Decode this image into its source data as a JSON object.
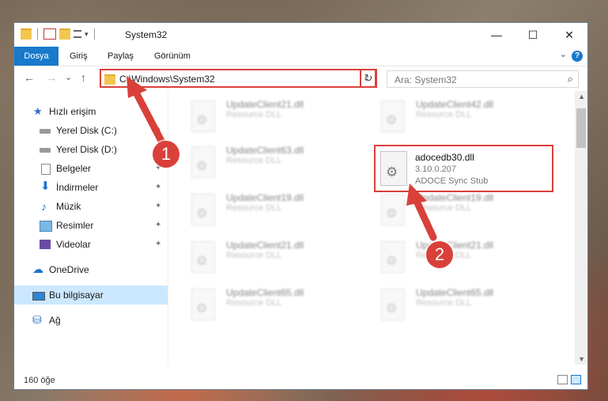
{
  "window": {
    "title": "System32",
    "minimize_glyph": "—",
    "maximize_glyph": "☐",
    "close_glyph": "✕"
  },
  "ribbon": {
    "tabs": [
      "Dosya",
      "Giriş",
      "Paylaş",
      "Görünüm"
    ],
    "help_glyph": "?",
    "collapse_glyph": "⌄"
  },
  "navigation": {
    "back_glyph": "←",
    "forward_glyph": "→",
    "recent_glyph": "⌄",
    "up_glyph": "↑",
    "address_path": "C:\\Windows\\System32",
    "address_dropdown_glyph": "⌄",
    "refresh_glyph": "↻",
    "search_placeholder": "Ara: System32",
    "search_glyph": "⌕"
  },
  "sidebar": {
    "items": [
      {
        "label": "Hızlı erişim",
        "icon": "star-icon",
        "pinned": false
      },
      {
        "label": "Yerel Disk (C:)",
        "icon": "drive-icon",
        "pinned": true
      },
      {
        "label": "Yerel Disk (D:)",
        "icon": "drive-icon",
        "pinned": true
      },
      {
        "label": "Belgeler",
        "icon": "documents-icon",
        "pinned": true
      },
      {
        "label": "İndirmeler",
        "icon": "download-icon",
        "pinned": true
      },
      {
        "label": "Müzik",
        "icon": "music-icon",
        "pinned": true
      },
      {
        "label": "Resimler",
        "icon": "pictures-icon",
        "pinned": true
      },
      {
        "label": "Videolar",
        "icon": "videos-icon",
        "pinned": true
      },
      {
        "label": "OneDrive",
        "icon": "cloud-icon",
        "pinned": false
      },
      {
        "label": "Bu bilgisayar",
        "icon": "computer-icon",
        "pinned": false,
        "selected": true
      },
      {
        "label": "Ağ",
        "icon": "network-icon",
        "pinned": false
      }
    ],
    "pin_glyph": "📌"
  },
  "files": [
    {
      "name": "UpdateClient21.dll",
      "type": "Resource DLL"
    },
    {
      "name": "UpdateClient42.dll",
      "type": "Resource DLL"
    },
    {
      "name": "UpdateClient63.dll",
      "type": "Resource DLL"
    },
    {
      "name": "UpdateClient19.dll",
      "type": "Resource DLL"
    },
    {
      "name": "UpdateClient19.dll",
      "type": "Resource DLL"
    },
    {
      "name": "UpdateClient21.dll",
      "type": "Resource DLL"
    },
    {
      "name": "UpdateClient21.dll",
      "type": "Resource DLL"
    },
    {
      "name": "UpdateClient65.dll",
      "type": "Resource DLL"
    },
    {
      "name": "UpdateClient65.dll",
      "type": "Resource DLL"
    }
  ],
  "highlighted_file": {
    "name": "adocedb30.dll",
    "version": "3.10.0.207",
    "description": "ADOCE Sync Stub"
  },
  "status": {
    "item_count": "160 öğe"
  },
  "annotations": {
    "step1": "1",
    "step2": "2",
    "color": "#d9403a"
  }
}
